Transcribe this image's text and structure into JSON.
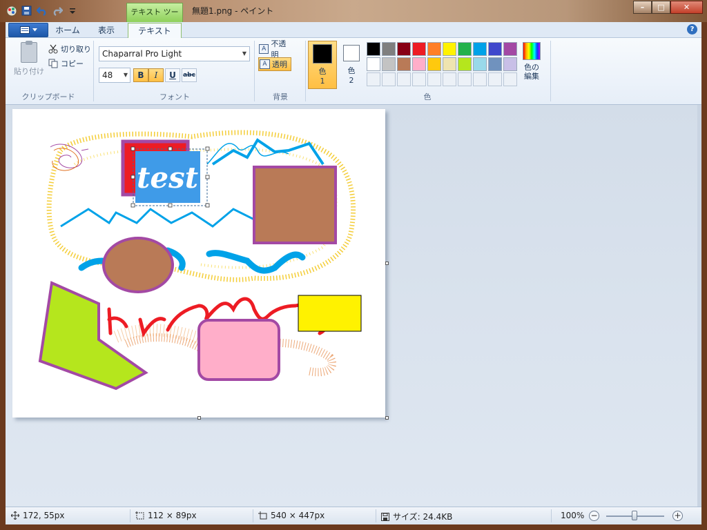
{
  "window": {
    "title": "無題1.png - ペイント",
    "context_tab": "テキスト ツール",
    "controls": {
      "minimize": "–",
      "maximize": "□",
      "close": "✕"
    }
  },
  "ribbon": {
    "tabs": [
      "ホーム",
      "表示",
      "テキスト"
    ],
    "active_tab": "テキスト",
    "help": "?",
    "clipboard": {
      "group_label": "クリップボード",
      "paste": "貼り付け",
      "cut": "切り取り",
      "copy": "コピー"
    },
    "font": {
      "group_label": "フォント",
      "family": "Chaparral Pro Light",
      "size": "48",
      "bold": "B",
      "italic": "I",
      "underline": "U",
      "strikethrough": "abc",
      "active": [
        "bold",
        "italic"
      ]
    },
    "background": {
      "group_label": "背景",
      "opaque": "不透明",
      "transparent": "透明",
      "selected": "transparent"
    },
    "colors": {
      "group_label": "色",
      "color1_label": "色",
      "color1_index": "1",
      "color1_value": "#000000",
      "color2_label": "色",
      "color2_index": "2",
      "color2_value": "#ffffff",
      "edit_colors_line1": "色の",
      "edit_colors_line2": "編集",
      "palette": [
        "#000000",
        "#7f7f7f",
        "#880015",
        "#ed1c24",
        "#ff7f27",
        "#fff200",
        "#22b14c",
        "#00a2e8",
        "#3f48cc",
        "#a349a4",
        "#ffffff",
        "#c3c3c3",
        "#b97a57",
        "#ffaec9",
        "#ffc90e",
        "#efe4b0",
        "#b5e61d",
        "#99d9ea",
        "#7092be",
        "#c8bfe7"
      ],
      "empty_slots": 10
    }
  },
  "canvas": {
    "text_box_text": "test",
    "text_box_bg": "#3f9be8"
  },
  "status": {
    "cursor": "172, 55px",
    "selection": "112 × 89px",
    "image_size": "540 × 447px",
    "file_size": "サイズ: 24.4KB",
    "zoom": "100%",
    "zoom_out": "−",
    "zoom_in": "+"
  }
}
